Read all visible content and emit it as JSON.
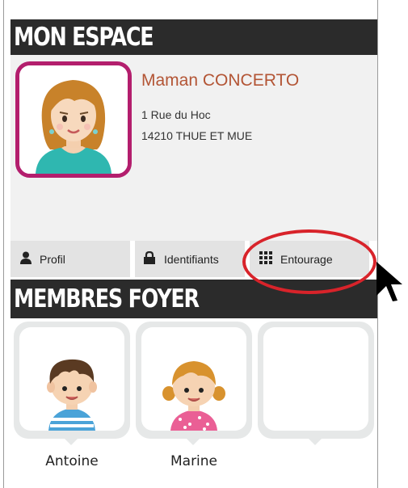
{
  "mon_espace": {
    "title": "MON ESPACE",
    "profile": {
      "name": "Maman CONCERTO",
      "address_line1": "1 Rue du Hoc",
      "address_line2": "14210 THUE ET MUE"
    },
    "tabs": [
      {
        "label": "Profil",
        "icon": "person-icon"
      },
      {
        "label": "Identifiants",
        "icon": "lock-icon"
      },
      {
        "label": "Entourage",
        "icon": "grid-icon"
      }
    ],
    "highlighted_tab": "Entourage"
  },
  "membres_foyer": {
    "title": "MEMBRES FOYER",
    "members": [
      {
        "name": "Antoine",
        "avatar": "boy-avatar"
      },
      {
        "name": "Marine",
        "avatar": "girl-avatar"
      },
      {
        "name": "",
        "avatar": "empty-slot"
      }
    ]
  },
  "colors": {
    "header_bg": "#2b2b2b",
    "avatar_border": "#b31e6d",
    "name_color": "#b35535",
    "highlight_ring": "#d8232a"
  }
}
